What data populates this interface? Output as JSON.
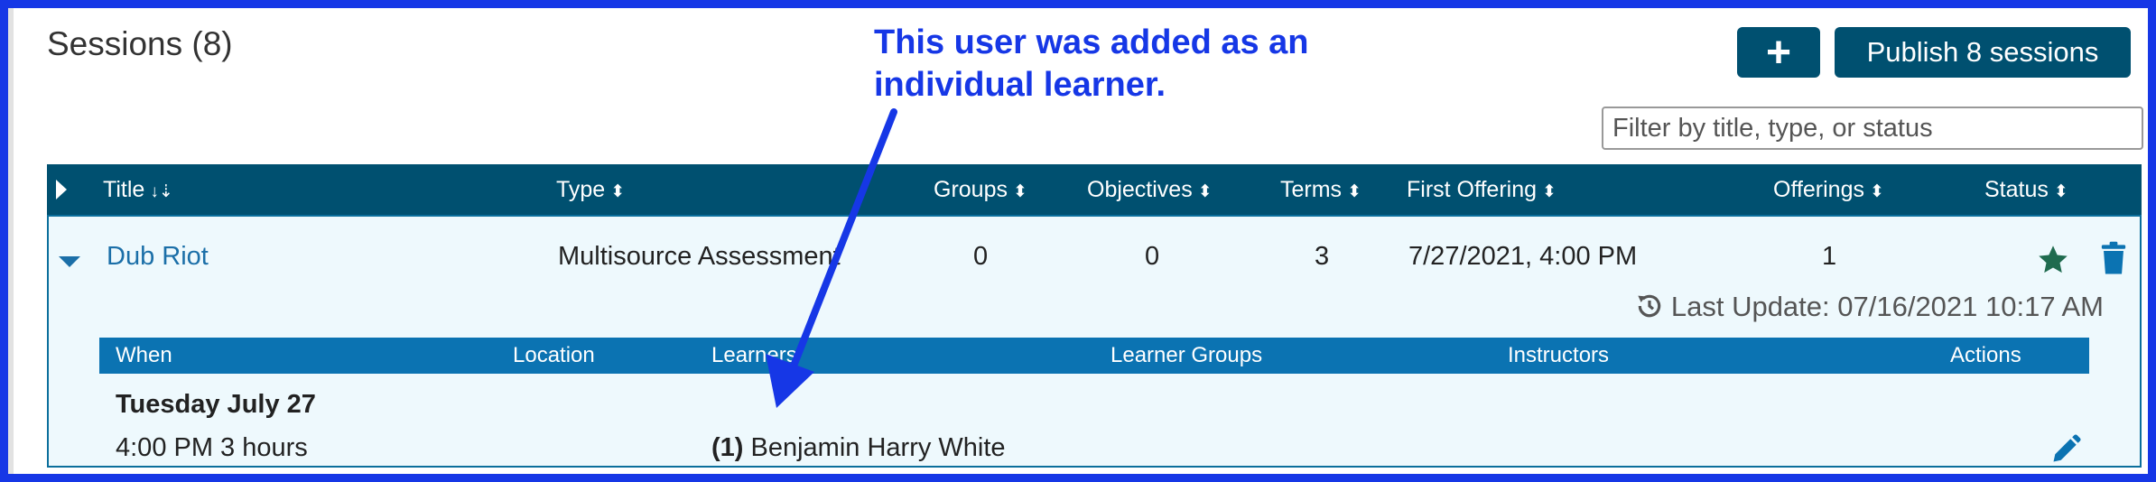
{
  "sessions": {
    "title": "Sessions (8)",
    "add_label": "+",
    "publish_label": "Publish 8 sessions",
    "filter_placeholder": "Filter by title, type, or status"
  },
  "table": {
    "columns": {
      "title": "Title",
      "type": "Type",
      "groups": "Groups",
      "objectives": "Objectives",
      "terms": "Terms",
      "first_offering": "First Offering",
      "offerings": "Offerings",
      "status": "Status"
    },
    "rows": [
      {
        "title": "Dub Riot",
        "type": "Multisource Assessment",
        "groups": "0",
        "objectives": "0",
        "terms": "3",
        "first_offering": "7/27/2021, 4:00 PM",
        "offerings": "1",
        "last_update": "Last Update: 07/16/2021 10:17 AM"
      }
    ]
  },
  "offerings": {
    "columns": {
      "when": "When",
      "location": "Location",
      "learners": "Learners",
      "learner_groups": "Learner Groups",
      "instructors": "Instructors",
      "actions": "Actions"
    },
    "date_heading": "Tuesday July 27",
    "time": "4:00 PM 3 hours",
    "learner_count": "(1)",
    "learner_name": "Benjamin Harry White"
  },
  "annotation": {
    "line1": "This user was added as an",
    "line2": "individual learner."
  },
  "colors": {
    "frame": "#1637e6",
    "header": "#005070",
    "subheader": "#0b73b2",
    "link": "#1b6fa8",
    "star": "#1f6b4f",
    "trash": "#0b73b2",
    "pencil": "#0b73b2"
  },
  "icons": [
    "expand-all-icon",
    "sort-icon",
    "collapse-icon",
    "star-icon",
    "trash-icon",
    "history-icon",
    "pencil-icon"
  ]
}
